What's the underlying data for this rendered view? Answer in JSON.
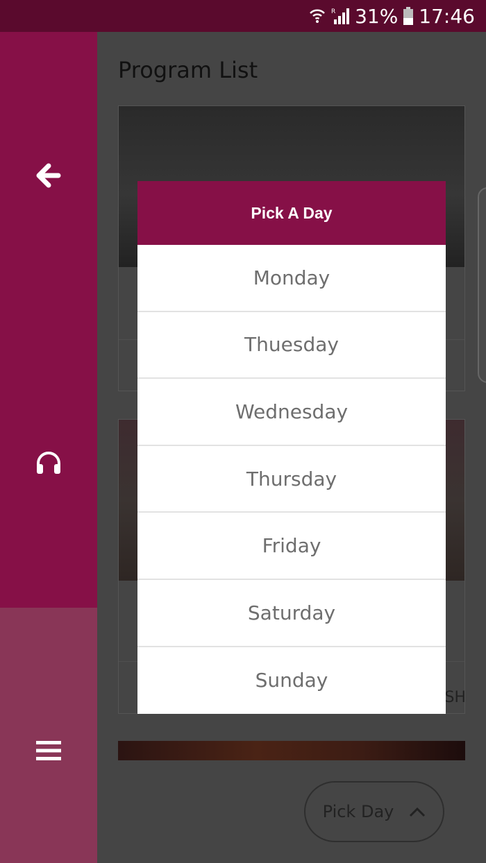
{
  "status_bar": {
    "battery_percent": "31%",
    "time": "17:46",
    "icons": [
      "wifi-icon",
      "signal-icon",
      "battery-icon"
    ]
  },
  "sidebar": {
    "top_color": "#861047",
    "bottom_color": "#893657",
    "items": [
      {
        "icon": "back-arrow-icon"
      },
      {
        "icon": "headphones-icon"
      },
      {
        "icon": "menu-icon"
      }
    ]
  },
  "content": {
    "title": "Program List",
    "card_trailing_text": "SH"
  },
  "fab": {
    "label": "Pick Day",
    "icon": "chevron-up-icon"
  },
  "dialog": {
    "title": "Pick A Day",
    "header_color": "#861047",
    "days": [
      "Monday",
      "Thuesday",
      "Wednesday",
      "Thursday",
      "Friday",
      "Saturday",
      "Sunday"
    ]
  }
}
